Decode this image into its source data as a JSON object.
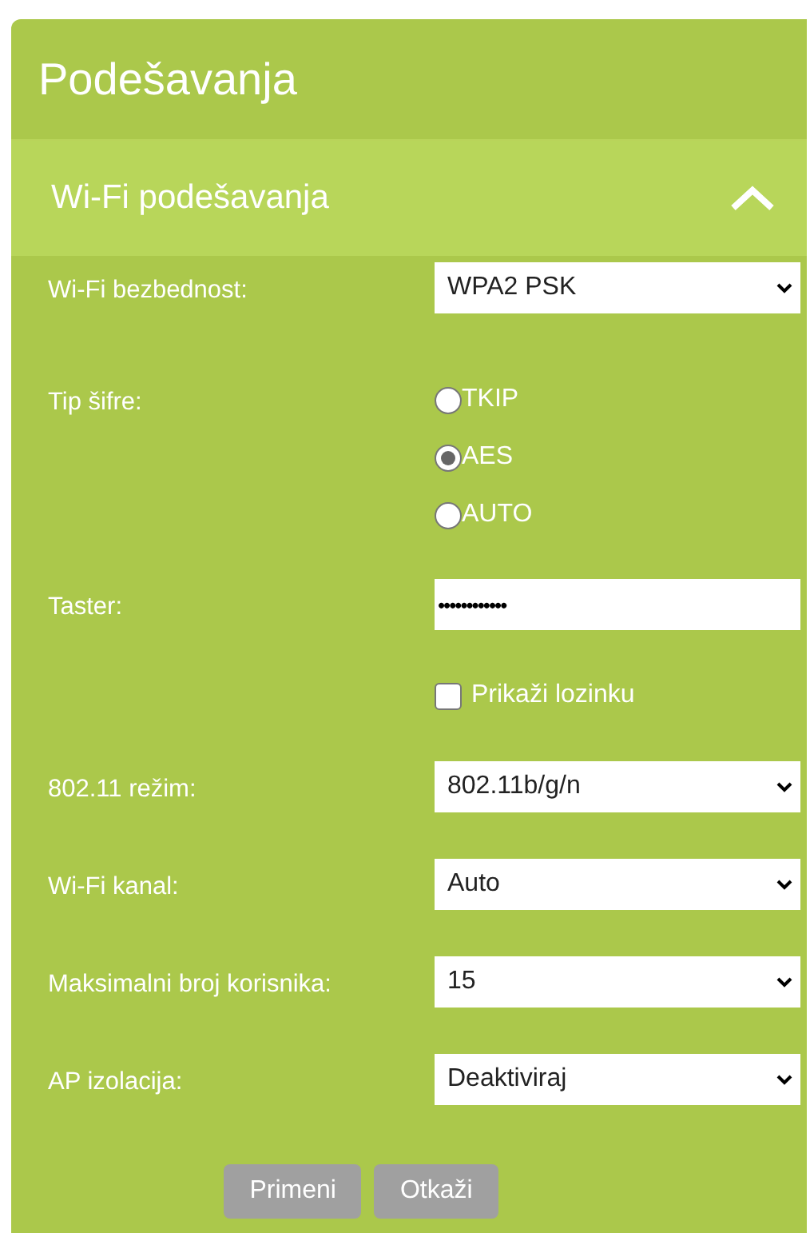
{
  "panel": {
    "title": "Podešavanja"
  },
  "section": {
    "title": "Wi-Fi podešavanja",
    "expanded": true
  },
  "fields": [
    {
      "kind": "select",
      "label": "Wi-Fi bezbednost:",
      "value": "WPA2 PSK"
    },
    {
      "kind": "radio",
      "label": "Tip šifre:",
      "options": [
        {
          "label": "TKIP",
          "selected": false
        },
        {
          "label": "AES",
          "selected": true
        },
        {
          "label": "AUTO",
          "selected": false
        }
      ]
    },
    {
      "kind": "password",
      "label": "Taster:",
      "value": "••••••••••••"
    },
    {
      "kind": "checkbox",
      "label": "Prikaži lozinku",
      "checked": false
    },
    {
      "kind": "select",
      "label": "802.11 režim:",
      "value": "802.11b/g/n"
    },
    {
      "kind": "select",
      "label": "Wi-Fi kanal:",
      "value": "Auto"
    },
    {
      "kind": "select",
      "label": "Maksimalni broj korisnika:",
      "value": "15"
    },
    {
      "kind": "select",
      "label": "AP izolacija:",
      "value": "Deaktiviraj"
    }
  ],
  "buttons": [
    {
      "label": "Primeni",
      "disabled": true
    },
    {
      "label": "Otkaži",
      "disabled": true
    }
  ]
}
